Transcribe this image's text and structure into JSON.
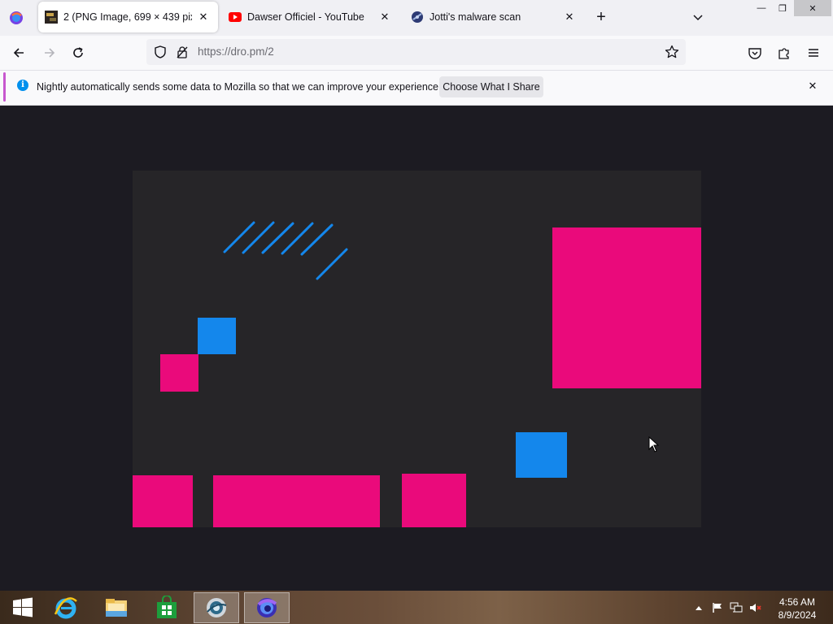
{
  "browser": {
    "tabs": [
      {
        "title": "2 (PNG Image, 699 × 439 pixels)",
        "active": true,
        "favicon": "image-thumbnail-icon"
      },
      {
        "title": "Dawser Officiel - YouTube",
        "active": false,
        "favicon": "youtube-icon"
      },
      {
        "title": "Jotti's malware scan",
        "active": false,
        "favicon": "jotti-icon"
      }
    ],
    "new_tab_label": "+",
    "close_glyph": "✕",
    "window_controls": {
      "minimize": "—",
      "restore": "❐",
      "close": "✕"
    },
    "url": "https://dro.pm/2"
  },
  "notification": {
    "info_glyph": "i",
    "message": "Nightly automatically sends some data to Mozilla so that we can improve your experience.",
    "button_label": "Choose What I Share",
    "close_glyph": "✕"
  },
  "image_viewer": {
    "background_color": "#1c1b22",
    "image_background": "#262528",
    "pink": "#ea0a7b",
    "blue": "#1487ec"
  },
  "taskbar": {
    "time": "4:56 AM",
    "date": "8/9/2024",
    "apps": [
      "start-button",
      "internet-explorer-icon",
      "file-explorer-icon",
      "store-icon",
      "browser-app-icon",
      "firefox-nightly-icon"
    ]
  }
}
